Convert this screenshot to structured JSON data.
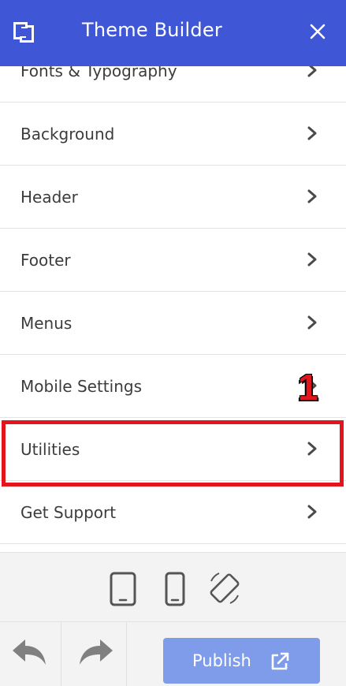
{
  "header": {
    "title": "Theme Builder",
    "logo_icon": "builder-logo-icon",
    "close_icon": "close-icon"
  },
  "menu": {
    "items": [
      {
        "label": "Fonts & Typography"
      },
      {
        "label": "Background"
      },
      {
        "label": "Header"
      },
      {
        "label": "Footer"
      },
      {
        "label": "Menus"
      },
      {
        "label": "Mobile Settings"
      },
      {
        "label": "Utilities"
      },
      {
        "label": "Get Support"
      }
    ]
  },
  "annotation": {
    "marker": "1"
  },
  "device_bar": {
    "icons": [
      "tablet-icon",
      "phone-icon",
      "rotate-icon"
    ]
  },
  "actions": {
    "publish_label": "Publish",
    "undo_icon": "undo-icon",
    "redo_icon": "redo-icon",
    "external_icon": "external-link-icon"
  },
  "colors": {
    "header_bg": "#3f57d6",
    "publish_bg": "#7f9cea",
    "highlight": "#e3141b"
  }
}
